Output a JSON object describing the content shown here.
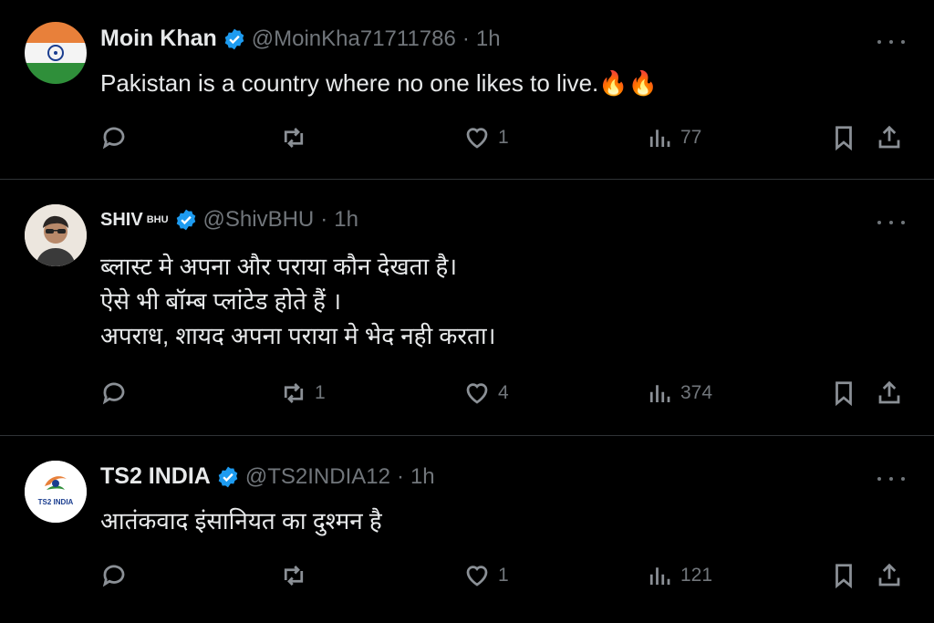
{
  "tweets": [
    {
      "name": "Moin Khan",
      "superscript": "",
      "handle": "@MoinKha71711786",
      "time": "1h",
      "lines": [
        "Pakistan is a country where no one likes to live.🔥🔥"
      ],
      "replies": "",
      "retweets": "",
      "likes": "1",
      "views": "77",
      "avatar": "indian-flag"
    },
    {
      "name": "SHIV",
      "superscript": "BHU",
      "handle": "@ShivBHU",
      "time": "1h",
      "lines": [
        "ब्लास्ट मे अपना और पराया कौन देखता है।",
        "ऐसे भी बॉम्ब प्लांटेड होते हैं ।",
        "अपराध, शायद अपना पराया मे भेद नही करता।"
      ],
      "replies": "",
      "retweets": "1",
      "likes": "4",
      "views": "374",
      "avatar": "person-photo"
    },
    {
      "name": "TS2 INDIA",
      "superscript": "",
      "handle": "@TS2INDIA12",
      "time": "1h",
      "lines": [
        "आतंकवाद इंसानियत का दुश्मन है"
      ],
      "replies": "",
      "retweets": "",
      "likes": "1",
      "views": "121",
      "avatar": "ts2-india-logo",
      "avatar_text": "TS2 INDIA"
    }
  ],
  "colors": {
    "background": "#000000",
    "text": "#e7e9ea",
    "secondary": "#71767b",
    "verified": "#1d9bf0",
    "divider": "#2f3336"
  },
  "dot_separator": "·"
}
